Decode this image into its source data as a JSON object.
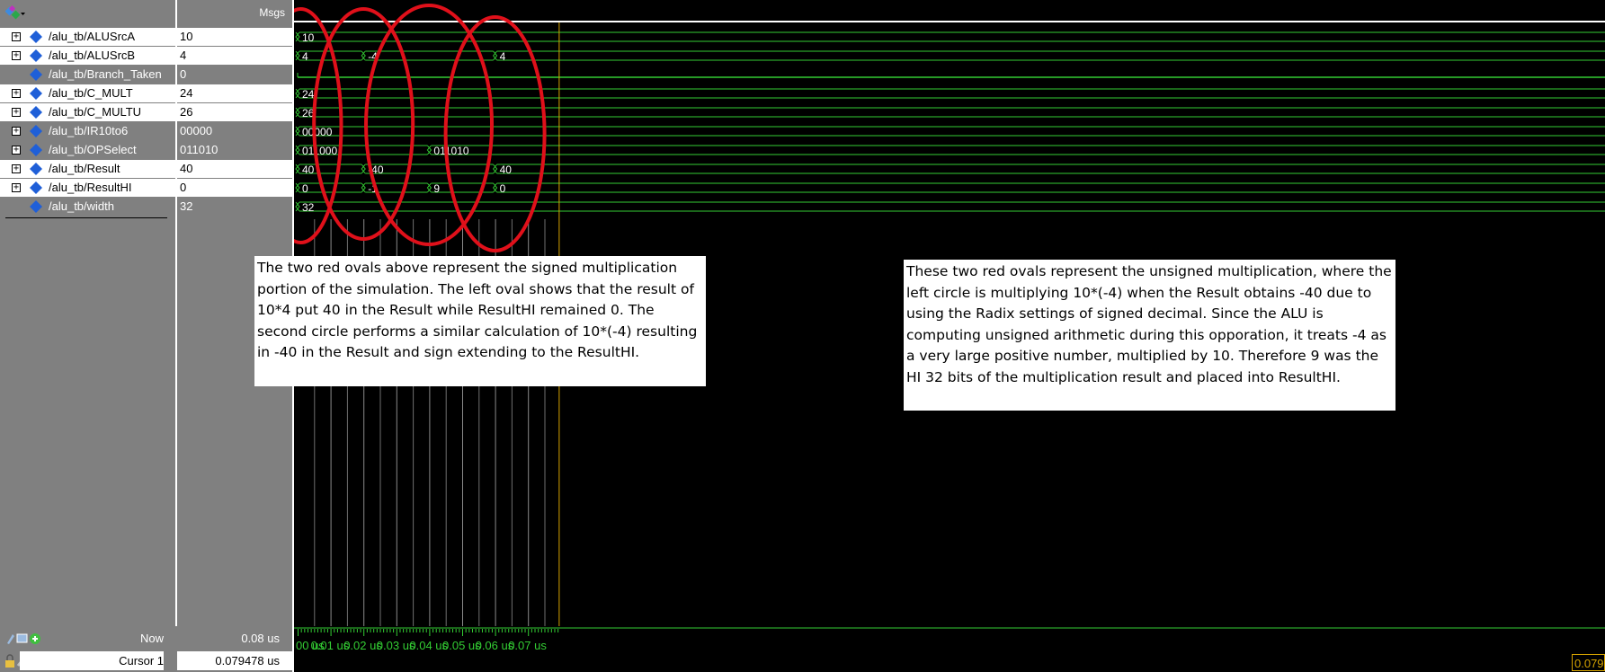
{
  "header": {
    "msgs_label": "Msgs"
  },
  "signals": [
    {
      "name": "/alu_tb/ALUSrcA",
      "value": "10",
      "expandable": true,
      "selected": false
    },
    {
      "name": "/alu_tb/ALUSrcB",
      "value": "4",
      "expandable": true,
      "selected": false
    },
    {
      "name": "/alu_tb/Branch_Taken",
      "value": "0",
      "expandable": false,
      "selected": true
    },
    {
      "name": "/alu_tb/C_MULT",
      "value": "24",
      "expandable": true,
      "selected": false
    },
    {
      "name": "/alu_tb/C_MULTU",
      "value": "26",
      "expandable": true,
      "selected": false
    },
    {
      "name": "/alu_tb/IR10to6",
      "value": "00000",
      "expandable": true,
      "selected": true
    },
    {
      "name": "/alu_tb/OPSelect",
      "value": "011010",
      "expandable": true,
      "selected": true
    },
    {
      "name": "/alu_tb/Result",
      "value": "40",
      "expandable": true,
      "selected": false
    },
    {
      "name": "/alu_tb/ResultHI",
      "value": "0",
      "expandable": true,
      "selected": false
    },
    {
      "name": "/alu_tb/width",
      "value": "32",
      "expandable": false,
      "selected": true
    }
  ],
  "waveform": {
    "time_unit": "us",
    "segments": [
      [
        {
          "t": 0,
          "v": "10"
        }
      ],
      [
        {
          "t": 0,
          "v": "4"
        },
        {
          "t": 0.02,
          "v": "-4"
        },
        {
          "t": 0.06,
          "v": "4"
        }
      ],
      [],
      [
        {
          "t": 0,
          "v": "24"
        }
      ],
      [
        {
          "t": 0,
          "v": "26"
        }
      ],
      [
        {
          "t": 0,
          "v": "00000"
        }
      ],
      [
        {
          "t": 0,
          "v": "011000"
        },
        {
          "t": 0.04,
          "v": "011010"
        }
      ],
      [
        {
          "t": 0,
          "v": "40"
        },
        {
          "t": 0.02,
          "v": "-40"
        },
        {
          "t": 0.06,
          "v": "40"
        }
      ],
      [
        {
          "t": 0,
          "v": "0"
        },
        {
          "t": 0.02,
          "v": "-1"
        },
        {
          "t": 0.04,
          "v": "9"
        },
        {
          "t": 0.06,
          "v": "0"
        }
      ],
      [
        {
          "t": 0,
          "v": "32"
        }
      ]
    ]
  },
  "annotations": {
    "left_note": "The two red ovals above represent the signed multiplication portion of the simulation. The left oval shows that the result of 10*4 put 40 in the Result while ResultHI remained 0. The second circle performs a similar calculation of 10*(-4) resulting in -40 in the Result and sign extending to the ResultHI.",
    "right_note": "These two red ovals represent the unsigned multiplication, where the left circle is multiplying 10*(-4) when the Result obtains -40 due to using the Radix settings of signed decimal. Since the ALU is computing unsigned arithmetic during this opporation, it treats -4 as a very large positive number, multiplied by 10. Therefore 9 was the HI 32 bits of the multiplication result and placed into ResultHI.",
    "oval_color": "#e0101a"
  },
  "status": {
    "now_label": "Now",
    "now_value": "0.08 us",
    "cursor_label": "Cursor 1",
    "cursor_value": "0.079478 us",
    "cursor_box_value": "0.079"
  },
  "timeline": {
    "tick_labels": [
      "00 us",
      "0.01 us",
      "0.02 us",
      "0.03 us",
      "0.04 us",
      "0.05 us",
      "0.06 us",
      "0.07 us"
    ],
    "tick_times": [
      0,
      0.01,
      0.02,
      0.03,
      0.04,
      0.05,
      0.06,
      0.07
    ]
  },
  "colors": {
    "wave": "#33cc33",
    "wave_text": "#ffffff",
    "grid": "#8a8a8a",
    "cursor": "#d4a200",
    "panel_gray": "#808080",
    "diamond": "#1f5fd8"
  }
}
